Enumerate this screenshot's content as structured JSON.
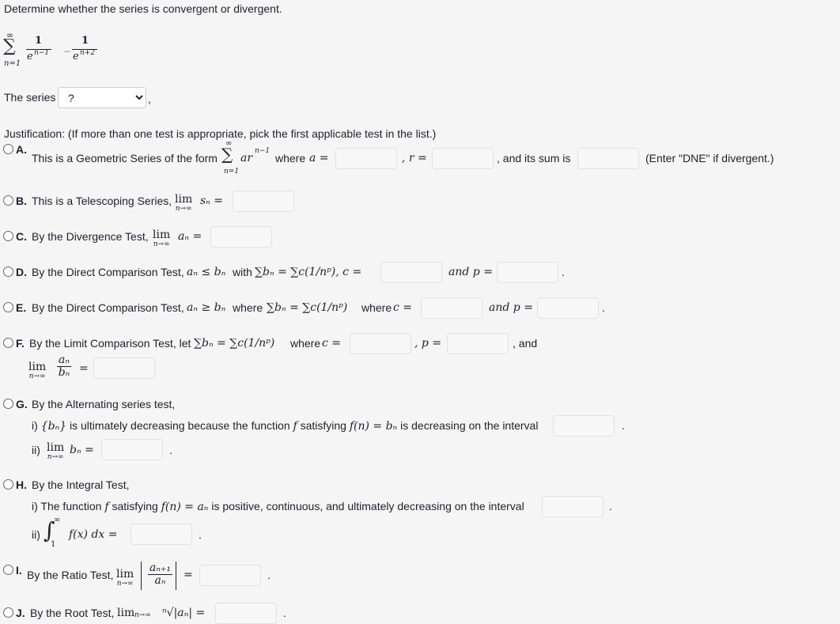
{
  "prompt": "Determine whether the series is convergent or divergent.",
  "series": {
    "sigma": "∑",
    "upper": "∞",
    "lower": "n=1",
    "term1_num": "1",
    "term1_den": "e",
    "term1_exp": "n−1",
    "minus": "−",
    "term2_num": "1",
    "term2_den": "e",
    "term2_exp": "n+2"
  },
  "series_select": {
    "label": "The series",
    "value": "?",
    "trailing": ","
  },
  "justification": "Justification: (If more than one test is appropriate, pick the first applicable test in the list.)",
  "options": {
    "A": {
      "label": "A.",
      "text": "This is a Geometric Series of the form",
      "formula": "ar",
      "exp": "n−1",
      "sum_upper": "∞",
      "sum_lower": "n=1",
      "where_a": "where",
      "a_eq": "a =",
      "r_eq": ", r =",
      "sum_is": ", and its sum is",
      "note": "(Enter \"DNE\" if divergent.)"
    },
    "B": {
      "label": "B.",
      "text": "This is a Telescoping Series,",
      "lim": "lim",
      "under": "n→∞",
      "expr": "sₙ ="
    },
    "C": {
      "label": "C.",
      "text": "By the Divergence Test,",
      "lim": "lim",
      "under": "n→∞",
      "expr": "aₙ ="
    },
    "D": {
      "label": "D.",
      "text": "By the Direct Comparison Test,",
      "expr1": "aₙ ≤ bₙ",
      "with": "with",
      "expr2": "∑bₙ = ∑c(1/nᵖ), c =",
      "and_p": "and p =",
      "end": "."
    },
    "E": {
      "label": "E.",
      "text": "By the Direct Comparison Test,",
      "expr1": "aₙ ≥ bₙ",
      "where": "where",
      "expr2": "∑bₙ = ∑c(1/nᵖ)",
      "where_c": "where",
      "c_eq": "c =",
      "and_p": "and p =",
      "end": "."
    },
    "F": {
      "label": "F.",
      "text": "By the Limit Comparison Test, let",
      "expr": "∑bₙ = ∑c(1/nᵖ)",
      "where": "where",
      "c_eq": "c =",
      "p_eq": ", p =",
      "and": ", and",
      "lim": "lim",
      "under": "n→∞",
      "ratio_num": "aₙ",
      "ratio_den": "bₙ",
      "eq": "="
    },
    "G": {
      "label": "G.",
      "text": "By the Alternating series test,",
      "i_prefix": "i)",
      "i_text1": "{bₙ}",
      "i_text2": "is ultimately decreasing because the function",
      "i_f": "f",
      "i_text3": "satisfying",
      "i_expr": "f(n) = bₙ",
      "i_text4": "is decreasing on the interval",
      "ii_prefix": "ii)",
      "lim": "lim",
      "under": "n→∞",
      "ii_expr": "bₙ =",
      "end": "."
    },
    "H": {
      "label": "H.",
      "text": "By the Integral Test,",
      "i_prefix": "i) The function",
      "i_f": "f",
      "i_text2": "satisfying",
      "i_expr": "f(n) = aₙ",
      "i_text3": "is positive, continuous, and ultimately decreasing on the interval",
      "ii_prefix": "ii)",
      "integral": "∫",
      "upper": "∞",
      "lower": "1",
      "integrand": "f(x) dx =",
      "end": "."
    },
    "I": {
      "label": "I.",
      "text": "By the Ratio Test,",
      "lim": "lim",
      "under": "n→∞",
      "num": "aₙ₊₁",
      "den": "aₙ",
      "eq": "=",
      "end": "."
    },
    "J": {
      "label": "J.",
      "text": "By the Root Test,",
      "lim": "lim",
      "under": "n→∞",
      "root": "ⁿ√|aₙ| =",
      "end": "."
    }
  }
}
